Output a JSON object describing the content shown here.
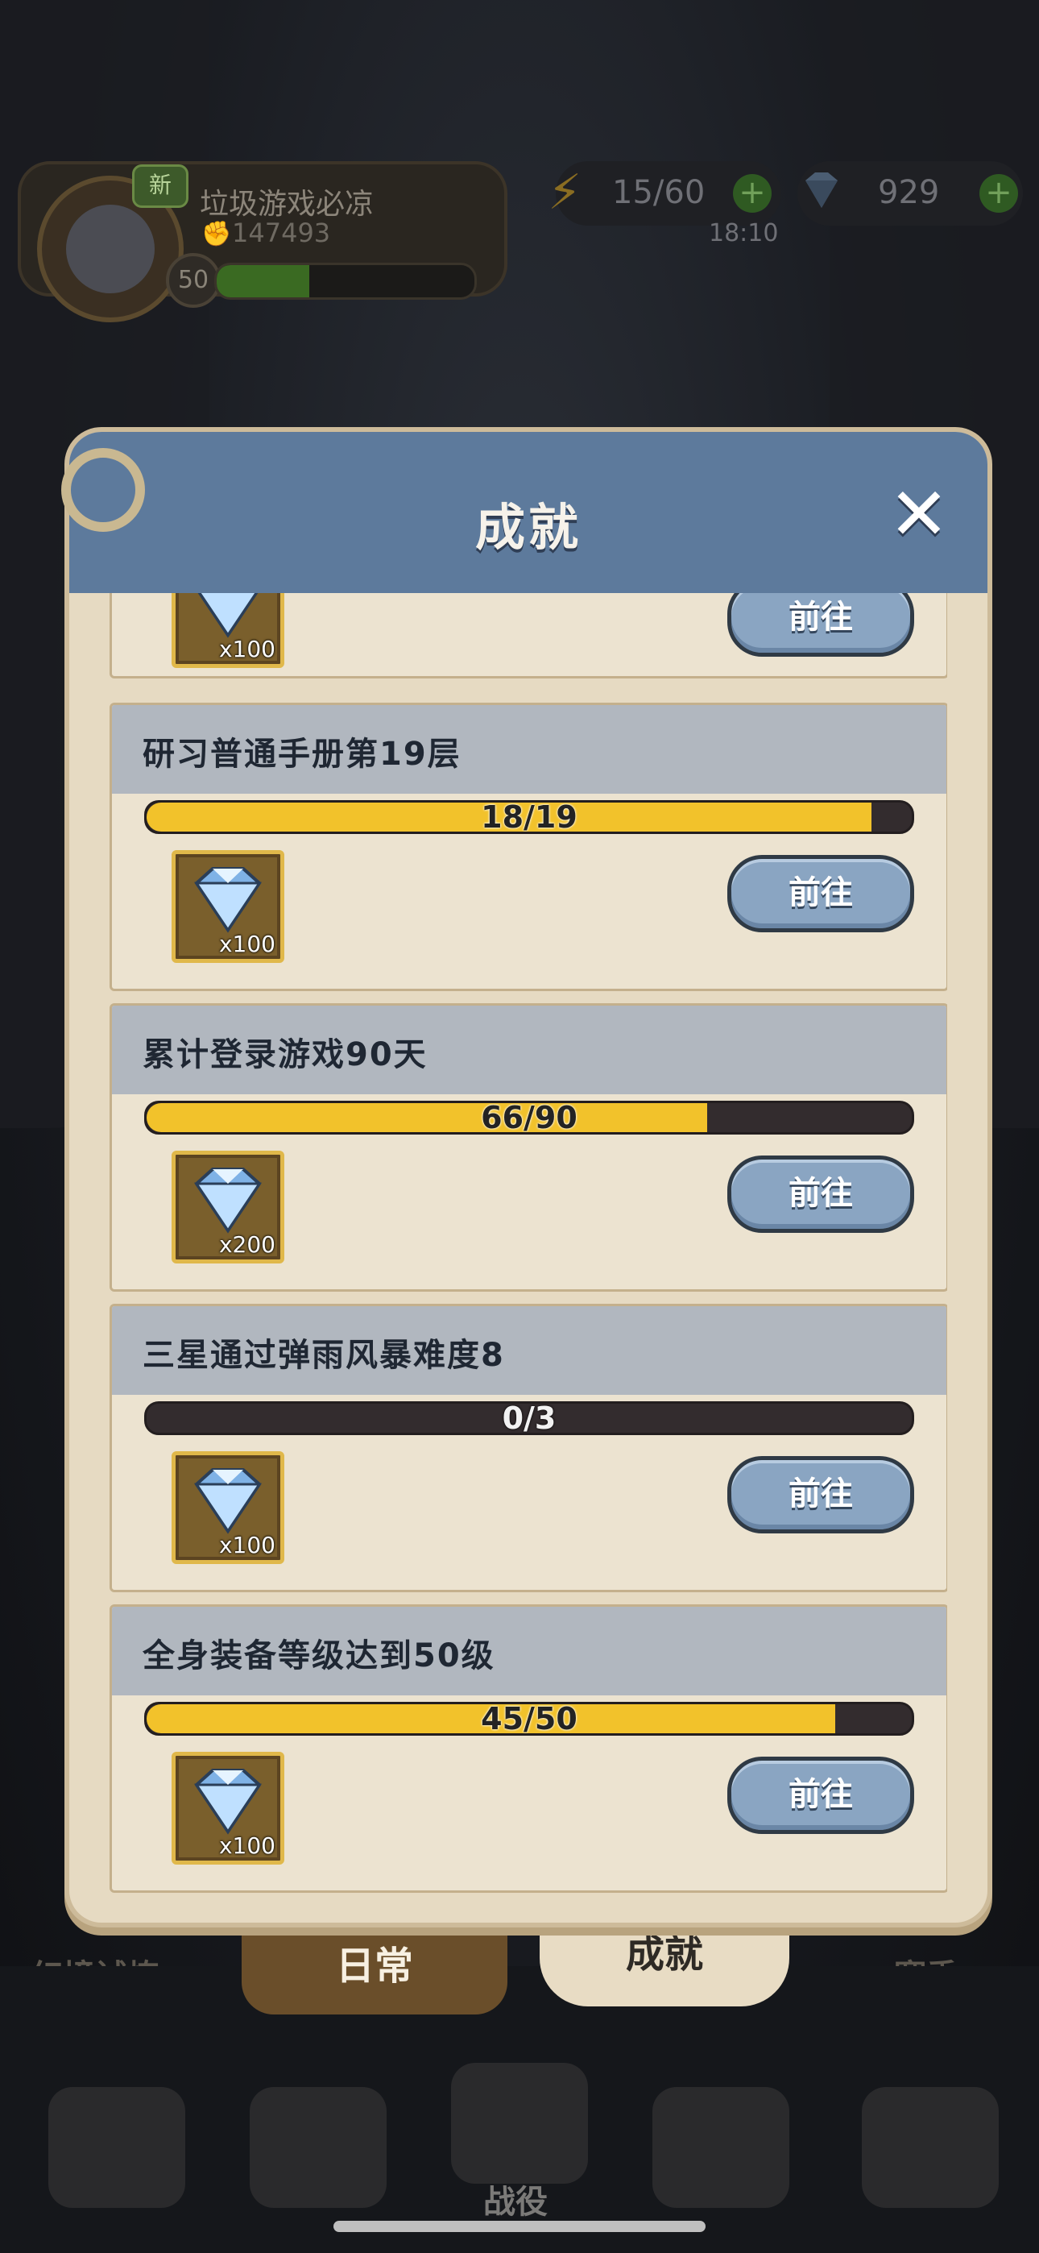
{
  "hud": {
    "new_badge": "新",
    "player_name": "垃圾游戏必凉",
    "power": "147493",
    "level": "50",
    "energy": "15/60",
    "timer": "18:10",
    "gems": "929"
  },
  "panel": {
    "title": "成就",
    "partial_card": {
      "reward_count": "x100",
      "button": "前往"
    },
    "achievements": [
      {
        "title": "研习普通手册第19层",
        "progress_text": "18/19",
        "progress": 0.947,
        "reward_count": "x100",
        "button": "前往"
      },
      {
        "title": "累计登录游戏90天",
        "progress_text": "66/90",
        "progress": 0.733,
        "reward_count": "x200",
        "button": "前往"
      },
      {
        "title": "三星通过弹雨风暴难度8",
        "progress_text": "0/3",
        "progress": 0,
        "reward_count": "x100",
        "button": "前往"
      },
      {
        "title": "全身装备等级达到50级",
        "progress_text": "45/50",
        "progress": 0.9,
        "reward_count": "x100",
        "button": "前往"
      }
    ]
  },
  "tabs": {
    "daily": "日常",
    "achievements": "成就"
  },
  "side": {
    "left_label": "幻境试炼",
    "right_label": "赛季"
  },
  "bottom_nav": {
    "center_label": "战役"
  },
  "colors": {
    "progress_fill": "#f2c22b",
    "header": "#5d7a9c",
    "button": "#8aa5c2"
  }
}
